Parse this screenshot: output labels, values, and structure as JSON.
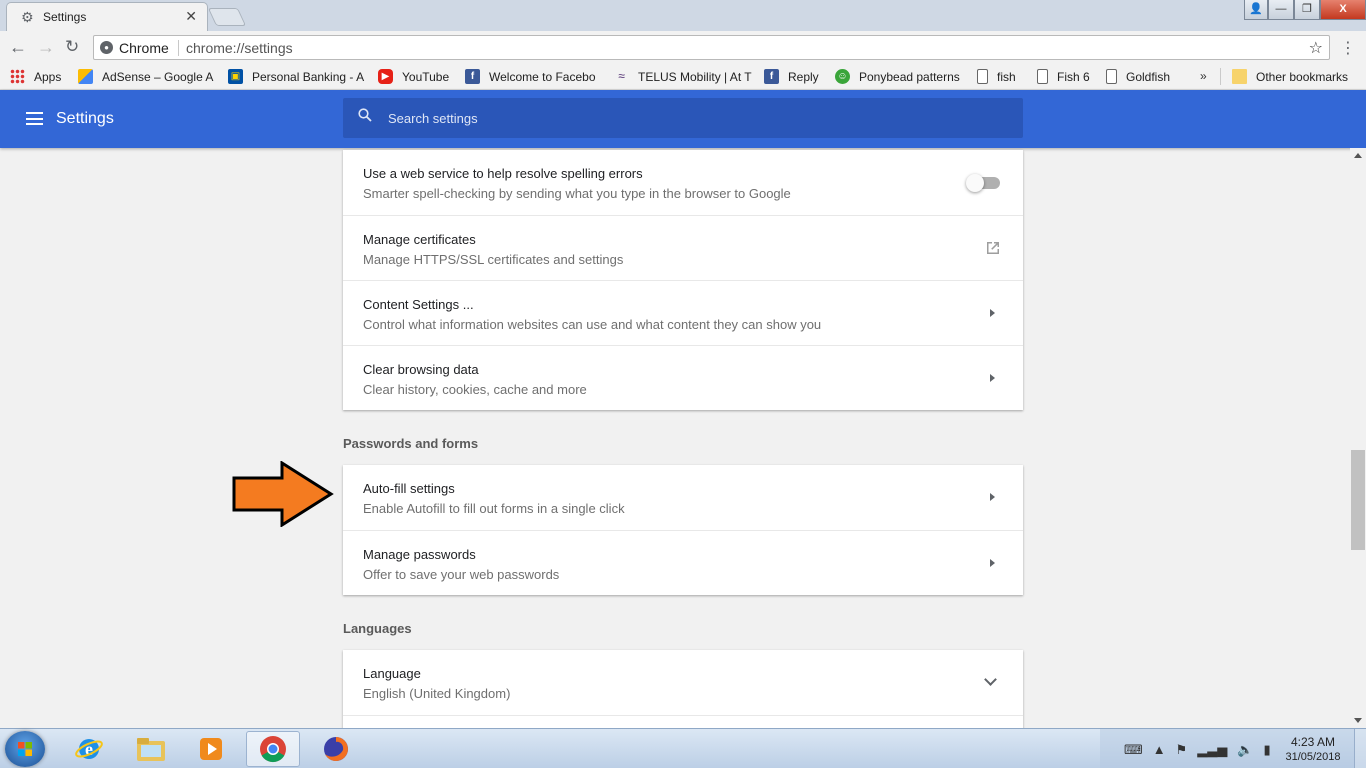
{
  "window": {
    "tab_title": "Settings",
    "tab_close": "✕",
    "controls": {
      "user": "👤",
      "minimize": "—",
      "maximize": "❐",
      "close": "X"
    }
  },
  "toolbar": {
    "omnibox_chip": "Chrome",
    "url": "chrome://settings",
    "star": "☆",
    "menu": "⋮"
  },
  "bookmarks": {
    "items": [
      {
        "label": "Apps"
      },
      {
        "label": "AdSense – Google A"
      },
      {
        "label": "Personal Banking - A"
      },
      {
        "label": "YouTube"
      },
      {
        "label": "Welcome to Facebo"
      },
      {
        "label": "TELUS Mobility | At T"
      },
      {
        "label": "Reply"
      },
      {
        "label": "Ponybead patterns"
      },
      {
        "label": "fish"
      },
      {
        "label": "Fish 6"
      },
      {
        "label": "Goldfish"
      }
    ],
    "more": "»",
    "other": "Other bookmarks"
  },
  "header": {
    "title": "Settings",
    "search_placeholder": "Search settings"
  },
  "settings": {
    "card1": [
      {
        "title": "Use a web service to help resolve spelling errors",
        "subtitle": "Smarter spell-checking by sending what you type in the browser to Google",
        "control": "toggle",
        "enabled": false
      },
      {
        "title": "Manage certificates",
        "subtitle": "Manage HTTPS/SSL certificates and settings",
        "control": "external-link"
      },
      {
        "title": "Content Settings ...",
        "subtitle": "Control what information websites can use and what content they can show you",
        "control": "arrow"
      },
      {
        "title": "Clear browsing data",
        "subtitle": "Clear history, cookies, cache and more",
        "control": "arrow"
      }
    ],
    "passwords_section": "Passwords and forms",
    "card2": [
      {
        "title": "Auto-fill settings",
        "subtitle": "Enable Autofill to fill out forms in a single click",
        "control": "arrow"
      },
      {
        "title": "Manage passwords",
        "subtitle": "Offer to save your web passwords",
        "control": "arrow"
      }
    ],
    "languages_section": "Languages",
    "card3": [
      {
        "title": "Language",
        "subtitle": "English (United Kingdom)",
        "control": "expand"
      }
    ]
  },
  "taskbar": {
    "clock_time": "4:23 AM",
    "clock_date": "31/05/2018"
  },
  "colors": {
    "header_blue": "#3367d6",
    "pointer_orange": "#f47b20"
  }
}
